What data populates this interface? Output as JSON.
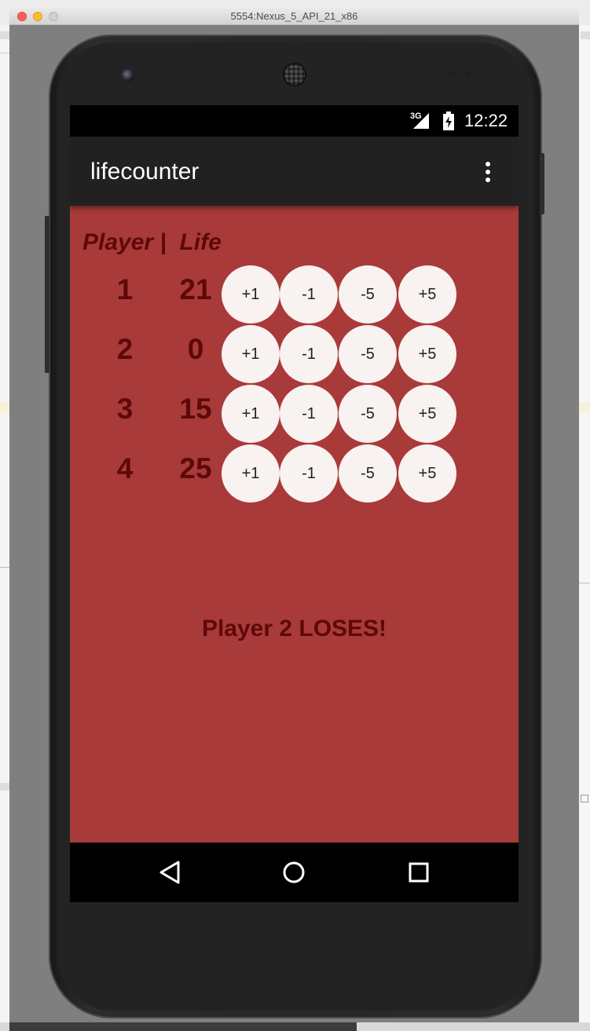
{
  "window": {
    "title": "5554:Nexus_5_API_21_x86"
  },
  "status_bar": {
    "network": "3G",
    "time": "12:22",
    "icons": [
      "signal-icon",
      "battery-charging-icon"
    ]
  },
  "app_bar": {
    "title": "lifecounter",
    "menu_icon": "overflow-menu-icon"
  },
  "table": {
    "header": "Player |  Life",
    "players": [
      {
        "number": "1",
        "life": "21",
        "buttons": [
          "+1",
          "-1",
          "-5",
          "+5"
        ]
      },
      {
        "number": "2",
        "life": "0",
        "buttons": [
          "+1",
          "-1",
          "-5",
          "+5"
        ]
      },
      {
        "number": "3",
        "life": "15",
        "buttons": [
          "+1",
          "-1",
          "-5",
          "+5"
        ]
      },
      {
        "number": "4",
        "life": "25",
        "buttons": [
          "+1",
          "-1",
          "-5",
          "+5"
        ]
      }
    ]
  },
  "message": "Player 2 LOSES!",
  "nav_bar": {
    "icons": [
      "back-icon",
      "home-icon",
      "recents-icon"
    ]
  },
  "colors": {
    "content_bg": "#a93a3a",
    "text_dark_red": "#5e0909",
    "button_bg": "#f8f2f1",
    "app_bar_bg": "#212121"
  }
}
